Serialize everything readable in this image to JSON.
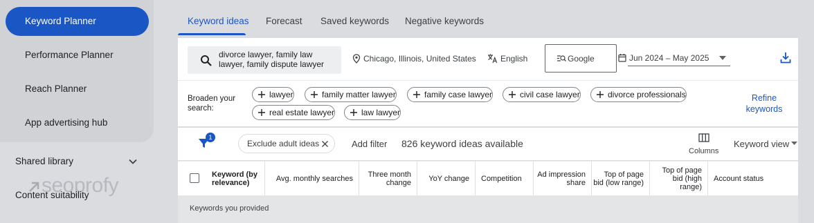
{
  "sidebar": {
    "items": [
      {
        "label": "Keyword Planner",
        "active": true
      },
      {
        "label": "Performance Planner"
      },
      {
        "label": "Reach Planner"
      },
      {
        "label": "App advertising hub"
      }
    ],
    "shared_library": "Shared library",
    "content_suitability": "Content suitability",
    "watermark": "seoprofy"
  },
  "tabs": [
    {
      "label": "Keyword ideas",
      "active": true
    },
    {
      "label": "Forecast"
    },
    {
      "label": "Saved keywords"
    },
    {
      "label": "Negative keywords"
    }
  ],
  "search": {
    "query": "divorce lawyer, family law lawyer, family dispute lawyer",
    "location": "Chicago, Illinois, United States",
    "language": "English",
    "network": "Google",
    "date_range": "Jun 2024 – May 2025"
  },
  "broaden": {
    "label": "Broaden your search:",
    "chips": [
      "lawyer",
      "family matter lawyer",
      "family case lawyer",
      "civil case lawyer",
      "divorce professionals",
      "real estate lawyer",
      "law lawyer"
    ],
    "refine_label": "Refine keywords"
  },
  "filters": {
    "badge_count": "1",
    "exclude_chip": "Exclude adult ideas",
    "add_filter": "Add filter",
    "ideas_count": "826 keyword ideas available",
    "columns_label": "Columns",
    "view_label": "Keyword view"
  },
  "table": {
    "columns": [
      "Keyword (by relevance)",
      "Avg. monthly searches",
      "Three month change",
      "YoY change",
      "Competition",
      "Ad impression share",
      "Top of page bid (low range)",
      "Top of page bid (high range)",
      "Account status"
    ],
    "section_label": "Keywords you provided"
  },
  "colors": {
    "accent": "#1a56c4",
    "background": "#dadce0"
  }
}
